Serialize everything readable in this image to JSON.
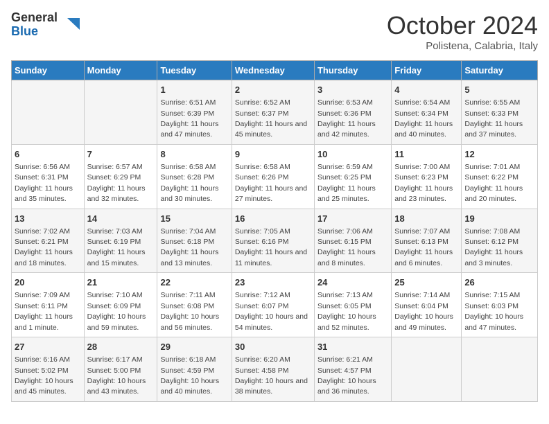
{
  "header": {
    "logo_general": "General",
    "logo_blue": "Blue",
    "month_title": "October 2024",
    "subtitle": "Polistena, Calabria, Italy"
  },
  "days_of_week": [
    "Sunday",
    "Monday",
    "Tuesday",
    "Wednesday",
    "Thursday",
    "Friday",
    "Saturday"
  ],
  "weeks": [
    [
      {
        "day": "",
        "info": ""
      },
      {
        "day": "",
        "info": ""
      },
      {
        "day": "1",
        "info": "Sunrise: 6:51 AM\nSunset: 6:39 PM\nDaylight: 11 hours and 47 minutes."
      },
      {
        "day": "2",
        "info": "Sunrise: 6:52 AM\nSunset: 6:37 PM\nDaylight: 11 hours and 45 minutes."
      },
      {
        "day": "3",
        "info": "Sunrise: 6:53 AM\nSunset: 6:36 PM\nDaylight: 11 hours and 42 minutes."
      },
      {
        "day": "4",
        "info": "Sunrise: 6:54 AM\nSunset: 6:34 PM\nDaylight: 11 hours and 40 minutes."
      },
      {
        "day": "5",
        "info": "Sunrise: 6:55 AM\nSunset: 6:33 PM\nDaylight: 11 hours and 37 minutes."
      }
    ],
    [
      {
        "day": "6",
        "info": "Sunrise: 6:56 AM\nSunset: 6:31 PM\nDaylight: 11 hours and 35 minutes."
      },
      {
        "day": "7",
        "info": "Sunrise: 6:57 AM\nSunset: 6:29 PM\nDaylight: 11 hours and 32 minutes."
      },
      {
        "day": "8",
        "info": "Sunrise: 6:58 AM\nSunset: 6:28 PM\nDaylight: 11 hours and 30 minutes."
      },
      {
        "day": "9",
        "info": "Sunrise: 6:58 AM\nSunset: 6:26 PM\nDaylight: 11 hours and 27 minutes."
      },
      {
        "day": "10",
        "info": "Sunrise: 6:59 AM\nSunset: 6:25 PM\nDaylight: 11 hours and 25 minutes."
      },
      {
        "day": "11",
        "info": "Sunrise: 7:00 AM\nSunset: 6:23 PM\nDaylight: 11 hours and 23 minutes."
      },
      {
        "day": "12",
        "info": "Sunrise: 7:01 AM\nSunset: 6:22 PM\nDaylight: 11 hours and 20 minutes."
      }
    ],
    [
      {
        "day": "13",
        "info": "Sunrise: 7:02 AM\nSunset: 6:21 PM\nDaylight: 11 hours and 18 minutes."
      },
      {
        "day": "14",
        "info": "Sunrise: 7:03 AM\nSunset: 6:19 PM\nDaylight: 11 hours and 15 minutes."
      },
      {
        "day": "15",
        "info": "Sunrise: 7:04 AM\nSunset: 6:18 PM\nDaylight: 11 hours and 13 minutes."
      },
      {
        "day": "16",
        "info": "Sunrise: 7:05 AM\nSunset: 6:16 PM\nDaylight: 11 hours and 11 minutes."
      },
      {
        "day": "17",
        "info": "Sunrise: 7:06 AM\nSunset: 6:15 PM\nDaylight: 11 hours and 8 minutes."
      },
      {
        "day": "18",
        "info": "Sunrise: 7:07 AM\nSunset: 6:13 PM\nDaylight: 11 hours and 6 minutes."
      },
      {
        "day": "19",
        "info": "Sunrise: 7:08 AM\nSunset: 6:12 PM\nDaylight: 11 hours and 3 minutes."
      }
    ],
    [
      {
        "day": "20",
        "info": "Sunrise: 7:09 AM\nSunset: 6:11 PM\nDaylight: 11 hours and 1 minute."
      },
      {
        "day": "21",
        "info": "Sunrise: 7:10 AM\nSunset: 6:09 PM\nDaylight: 10 hours and 59 minutes."
      },
      {
        "day": "22",
        "info": "Sunrise: 7:11 AM\nSunset: 6:08 PM\nDaylight: 10 hours and 56 minutes."
      },
      {
        "day": "23",
        "info": "Sunrise: 7:12 AM\nSunset: 6:07 PM\nDaylight: 10 hours and 54 minutes."
      },
      {
        "day": "24",
        "info": "Sunrise: 7:13 AM\nSunset: 6:05 PM\nDaylight: 10 hours and 52 minutes."
      },
      {
        "day": "25",
        "info": "Sunrise: 7:14 AM\nSunset: 6:04 PM\nDaylight: 10 hours and 49 minutes."
      },
      {
        "day": "26",
        "info": "Sunrise: 7:15 AM\nSunset: 6:03 PM\nDaylight: 10 hours and 47 minutes."
      }
    ],
    [
      {
        "day": "27",
        "info": "Sunrise: 6:16 AM\nSunset: 5:02 PM\nDaylight: 10 hours and 45 minutes."
      },
      {
        "day": "28",
        "info": "Sunrise: 6:17 AM\nSunset: 5:00 PM\nDaylight: 10 hours and 43 minutes."
      },
      {
        "day": "29",
        "info": "Sunrise: 6:18 AM\nSunset: 4:59 PM\nDaylight: 10 hours and 40 minutes."
      },
      {
        "day": "30",
        "info": "Sunrise: 6:20 AM\nSunset: 4:58 PM\nDaylight: 10 hours and 38 minutes."
      },
      {
        "day": "31",
        "info": "Sunrise: 6:21 AM\nSunset: 4:57 PM\nDaylight: 10 hours and 36 minutes."
      },
      {
        "day": "",
        "info": ""
      },
      {
        "day": "",
        "info": ""
      }
    ]
  ]
}
